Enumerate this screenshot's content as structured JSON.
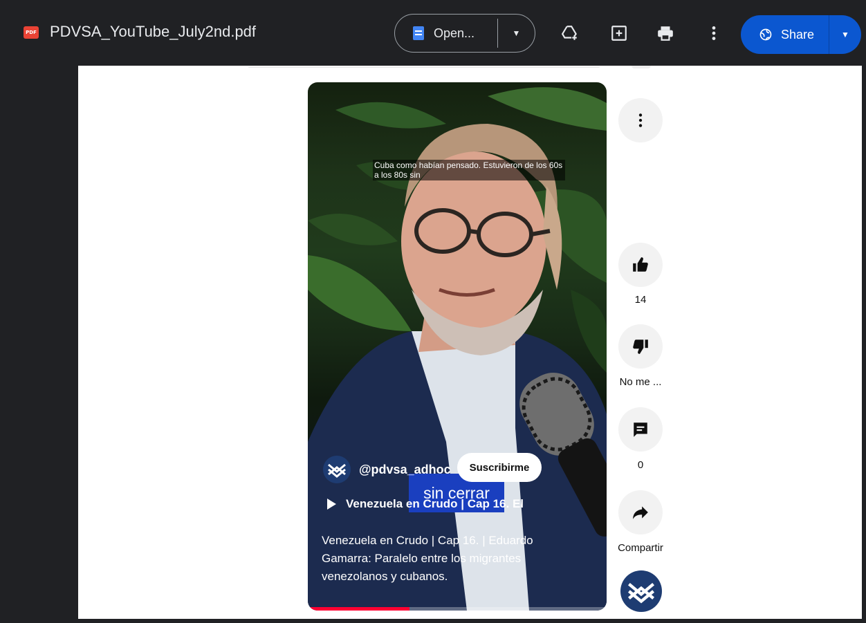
{
  "topbar": {
    "file_badge": "PDF",
    "file_title": "PDVSA_YouTube_July2nd.pdf",
    "open_label": "Open...",
    "share_label": "Share"
  },
  "video": {
    "top_caption": "Cuba como habían pensado. Estuvieron de los 60s a los 80s sin",
    "channel_handle": "@pdvsa_adhoc",
    "subscribe_label": "Suscribirme",
    "overlay_caption": "sin cerrar",
    "short_title": "Venezuela en Crudo | Cap 16. El",
    "description": "Venezuela en Crudo | Cap 16. | Eduardo Gamarra: Paralelo entre los migrantes venezolanos y cubanos.",
    "progress_fraction": 0.34
  },
  "actions": {
    "like_count": "14",
    "dislike_label": "No me ...",
    "comment_count": "0",
    "share_label": "Compartir"
  },
  "colors": {
    "topbar_bg": "#202124",
    "share_blue": "#0b57d0",
    "pdf_red": "#ea4335",
    "progress_red": "#ff0033"
  }
}
